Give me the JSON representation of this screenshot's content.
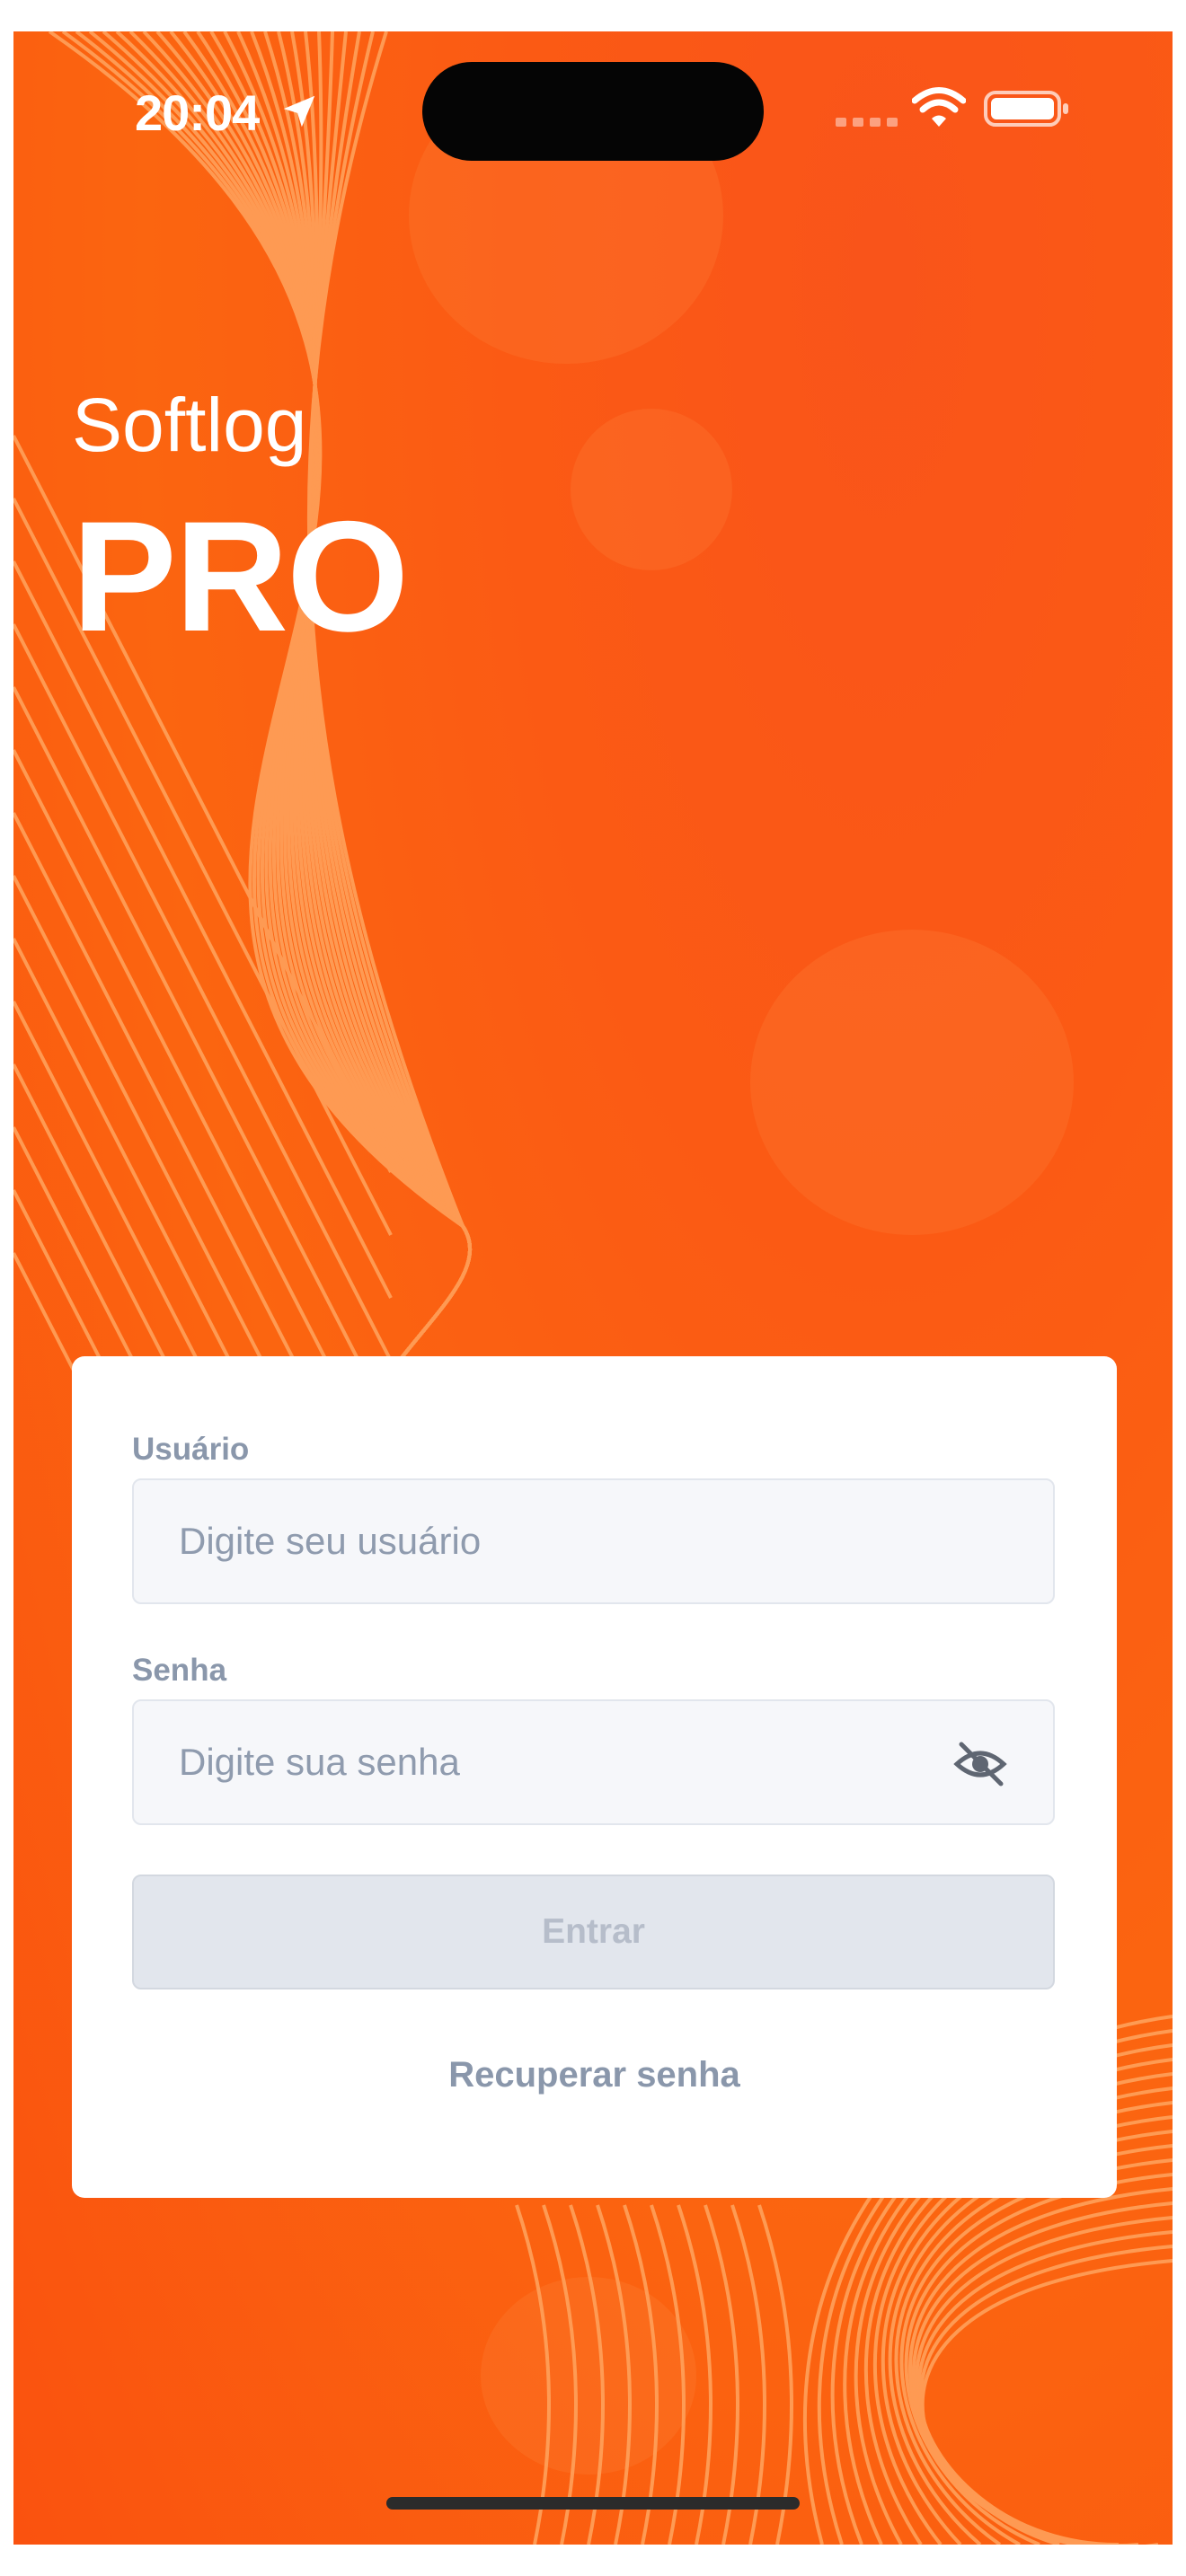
{
  "status_bar": {
    "time": "20:04",
    "icons": [
      "location-arrow-icon",
      "cellular-signal-icon",
      "wifi-icon",
      "battery-icon"
    ]
  },
  "brand": {
    "name_small": "Softlog",
    "name_large": "PRO"
  },
  "login_form": {
    "user_label": "Usuário",
    "user_placeholder": "Digite seu usuário",
    "password_label": "Senha",
    "password_placeholder": "Digite sua senha",
    "submit_label": "Entrar",
    "recover_link": "Recuperar senha"
  },
  "colors": {
    "background": "#fb5a14",
    "card": "#ffffff",
    "label": "#8a97ab",
    "button_disabled": "#e2e6ed"
  }
}
